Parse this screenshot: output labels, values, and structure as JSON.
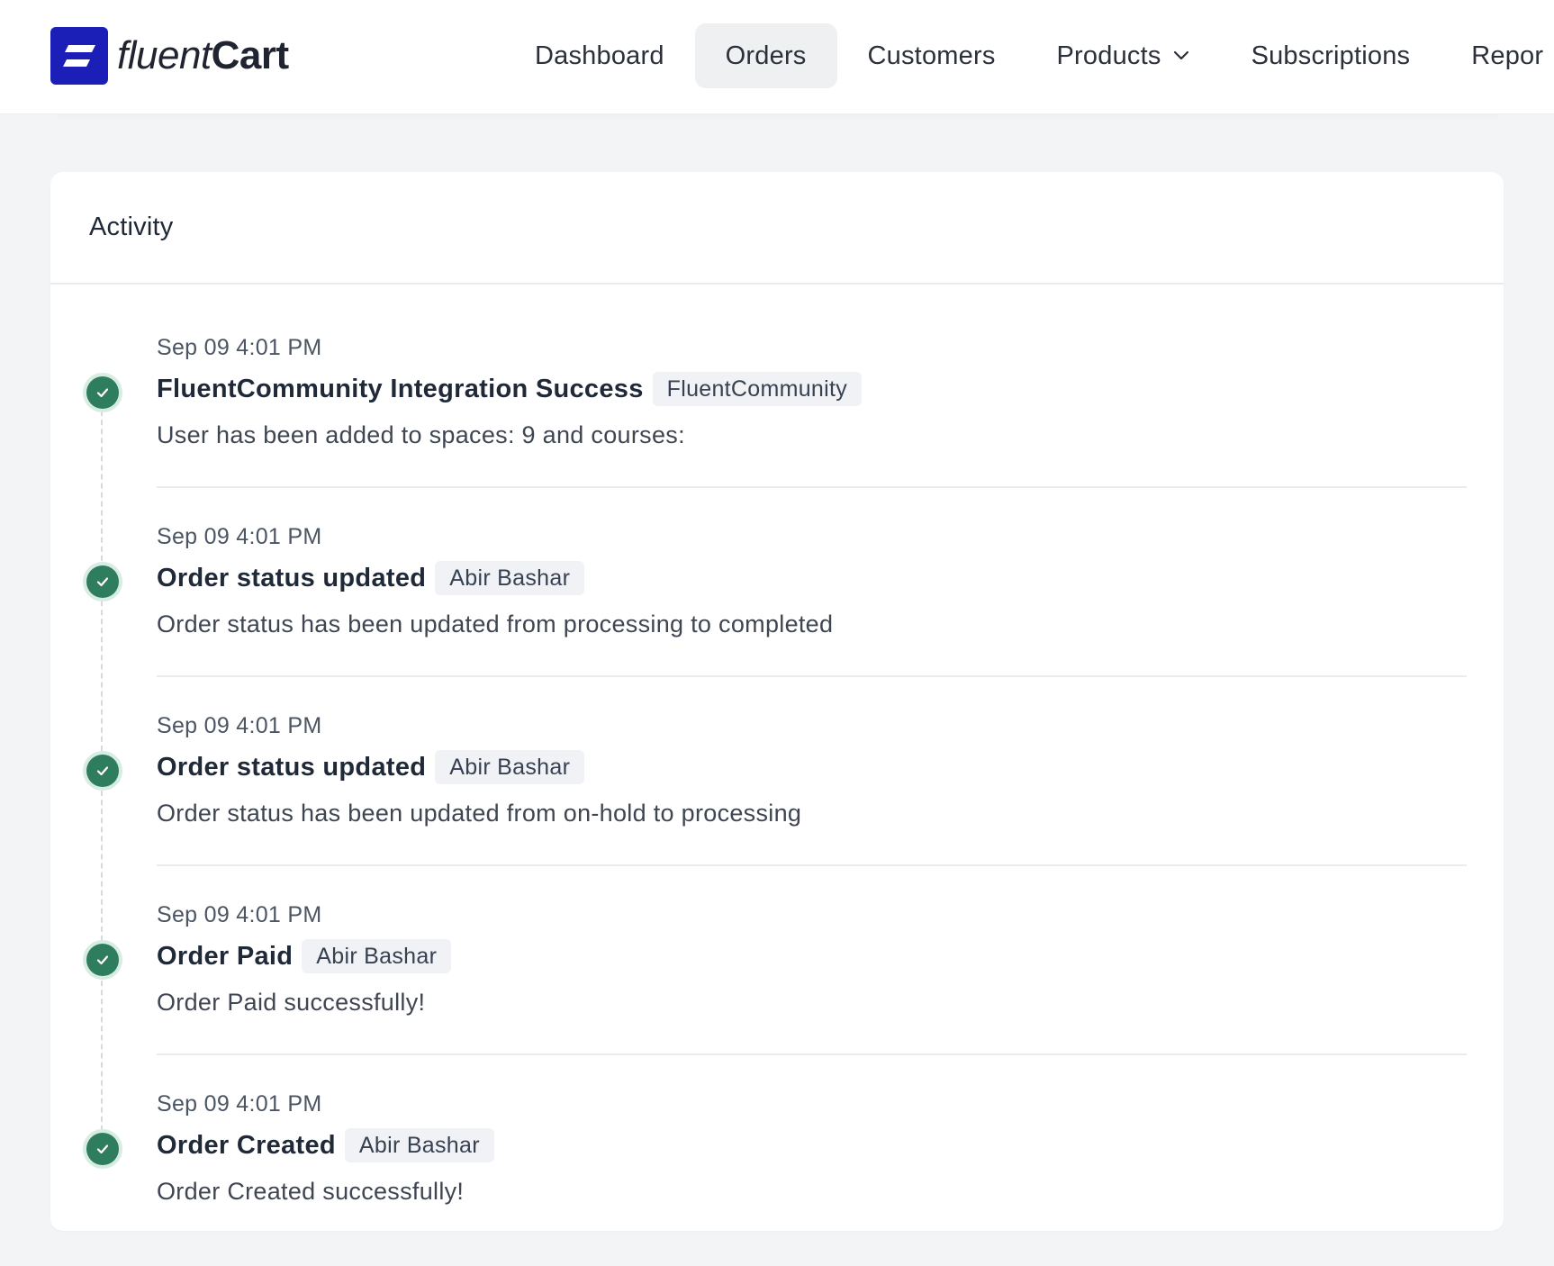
{
  "brand": {
    "name_light": "fluent",
    "name_bold": "Cart",
    "logo_icon": "fluentcart-logo-icon",
    "accent": "#1b1fb8"
  },
  "nav": {
    "items": [
      {
        "label": "Dashboard",
        "active": false
      },
      {
        "label": "Orders",
        "active": true
      },
      {
        "label": "Customers",
        "active": false
      },
      {
        "label": "Products",
        "active": false,
        "has_dropdown": true
      },
      {
        "label": "Subscriptions",
        "active": false
      },
      {
        "label": "Repor",
        "active": false
      }
    ]
  },
  "activity": {
    "title": "Activity",
    "status_color": "#2f7d5f",
    "entries": [
      {
        "time": "Sep 09 4:01 PM",
        "title": "FluentCommunity Integration Success",
        "tag": "FluentCommunity",
        "description": "User has been added to spaces: 9 and courses:"
      },
      {
        "time": "Sep 09 4:01 PM",
        "title": "Order status updated",
        "tag": "Abir Bashar",
        "description": "Order status has been updated from processing to completed"
      },
      {
        "time": "Sep 09 4:01 PM",
        "title": "Order status updated",
        "tag": "Abir Bashar",
        "description": "Order status has been updated from on-hold to processing"
      },
      {
        "time": "Sep 09 4:01 PM",
        "title": "Order Paid",
        "tag": "Abir Bashar",
        "description": "Order Paid successfully!"
      },
      {
        "time": "Sep 09 4:01 PM",
        "title": "Order Created",
        "tag": "Abir Bashar",
        "description": "Order Created successfully!"
      }
    ]
  }
}
